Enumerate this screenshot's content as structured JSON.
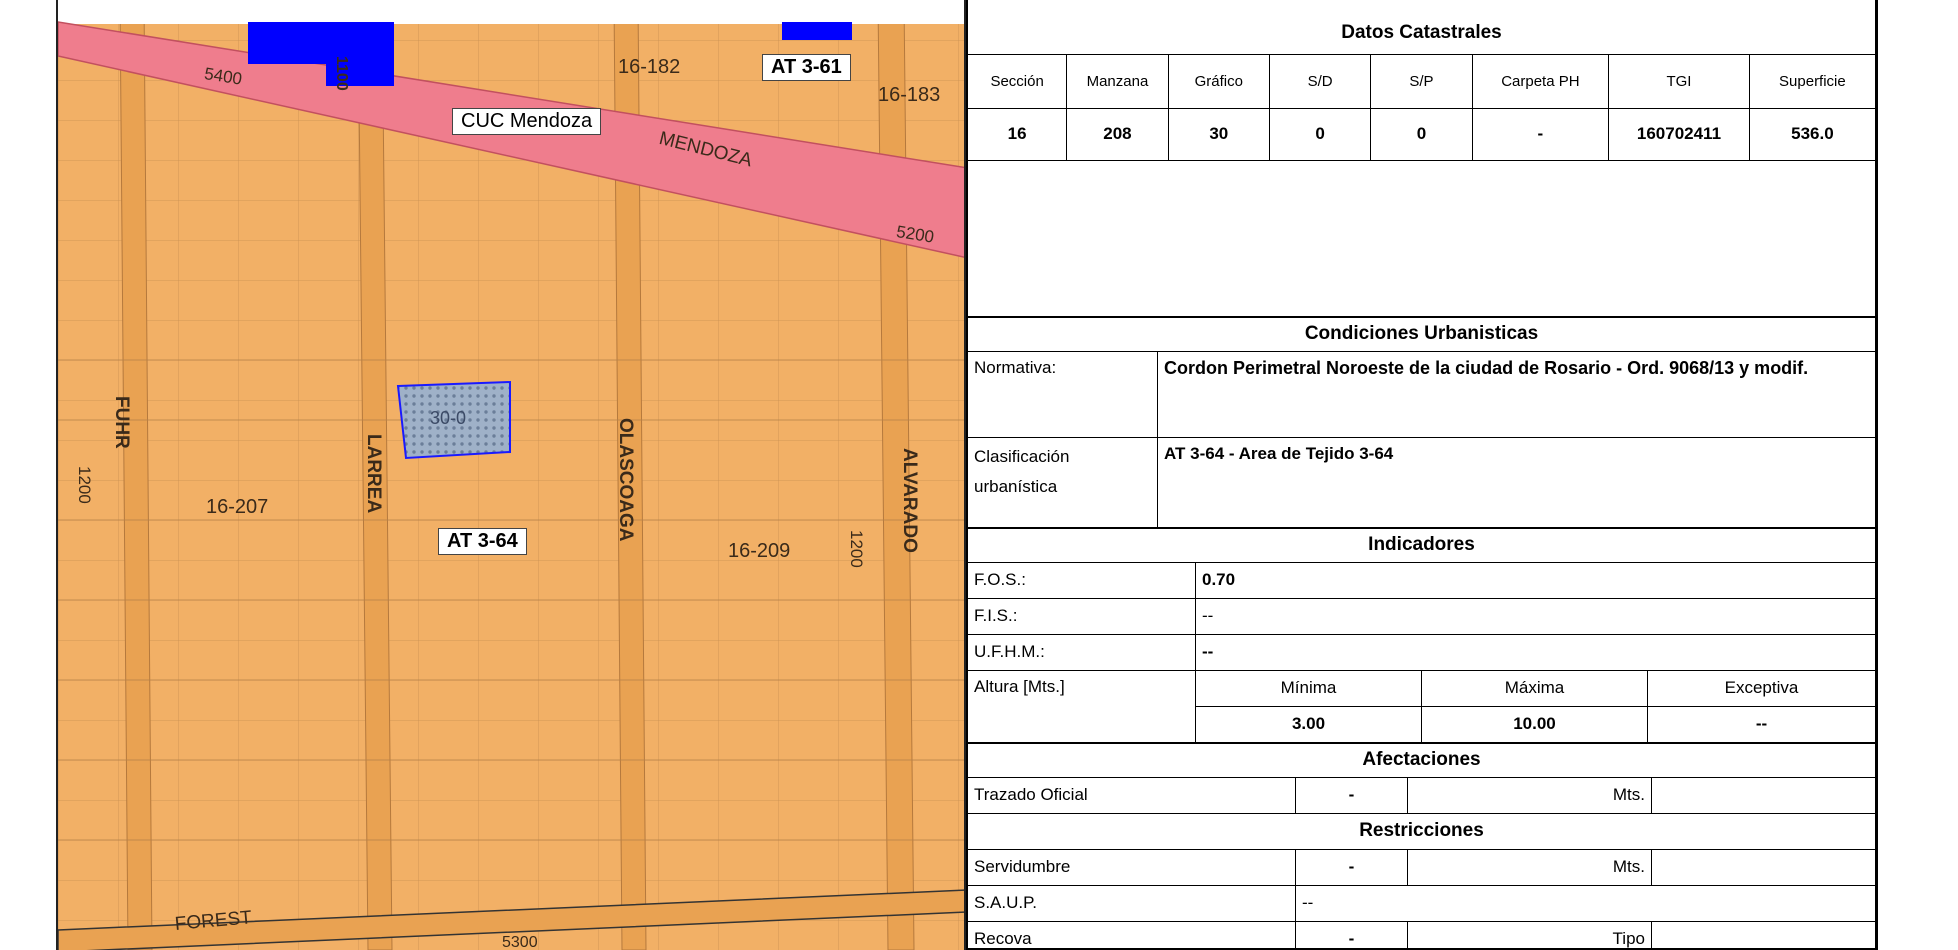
{
  "map": {
    "labels": {
      "lot_16_182": "16-182",
      "lot_16_183": "16-183",
      "lot_16_207": "16-207",
      "lot_16_209": "16-209",
      "num_5400": "5400",
      "num_5200": "5200",
      "num_5300": "5300",
      "num_1100": "1100",
      "num_1200_left": "1200",
      "num_1200_right": "1200",
      "street_mendoza": "MENDOZA",
      "street_fuhr": "FUHR",
      "street_larrea": "LARREA",
      "street_olascoaga": "OLASCOAGA",
      "street_alvarado": "ALVARADO",
      "street_forest": "FOREST",
      "parcel": "30-0",
      "zone_at361": "AT 3-61",
      "zone_cuc": "CUC Mendoza",
      "zone_at364": "AT 3-64"
    },
    "colors": {
      "blocks": "#f2b066",
      "streets": "#e8a04e",
      "avenue": "#ef7d8d",
      "buildings": "#0000ff",
      "parcel": "#8fa7c9"
    }
  },
  "catastro": {
    "title": "Datos Catastrales",
    "headers": [
      "Sección",
      "Manzana",
      "Gráfico",
      "S/D",
      "S/P",
      "Carpeta PH",
      "TGI",
      "Superficie"
    ],
    "values": [
      "16",
      "208",
      "30",
      "0",
      "0",
      "-",
      "160702411",
      "536.0"
    ]
  },
  "condiciones": {
    "title": "Condiciones Urbanisticas",
    "normativa_label": "Normativa:",
    "normativa_value": "Cordon Perimetral Noroeste de la ciudad de Rosario - Ord. 9068/13 y modif.",
    "clasificacion_label_1": "Clasificación",
    "clasificacion_label_2": "urbanística",
    "clasificacion_value": "AT 3-64 - Area de Tejido 3-64"
  },
  "indicadores": {
    "title": "Indicadores",
    "fos_label": "F.O.S.:",
    "fos_value": "0.70",
    "fis_label": "F.I.S.:",
    "fis_value": "--",
    "ufhm_label": "U.F.H.M.:",
    "ufhm_value": "--",
    "altura_label": "Altura [Mts.]",
    "minima_label": "Mínima",
    "maxima_label": "Máxima",
    "excepcional_label": "Exceptiva",
    "minima_value": "3.00",
    "maxima_value": "10.00",
    "excepcional_value": "--"
  },
  "afectaciones": {
    "title": "Afectaciones",
    "trazado_label": "Trazado Oficial",
    "trazado_value": "-",
    "trazado_unit": "Mts."
  },
  "restricciones": {
    "title": "Restricciones",
    "servidumbre_label": "Servidumbre",
    "servidumbre_value": "-",
    "servidumbre_unit": "Mts.",
    "saup_label": "S.A.U.P.",
    "saup_value": "--",
    "recova_label": "Recova",
    "recova_value": "-",
    "recova_unit": "Tipo"
  }
}
